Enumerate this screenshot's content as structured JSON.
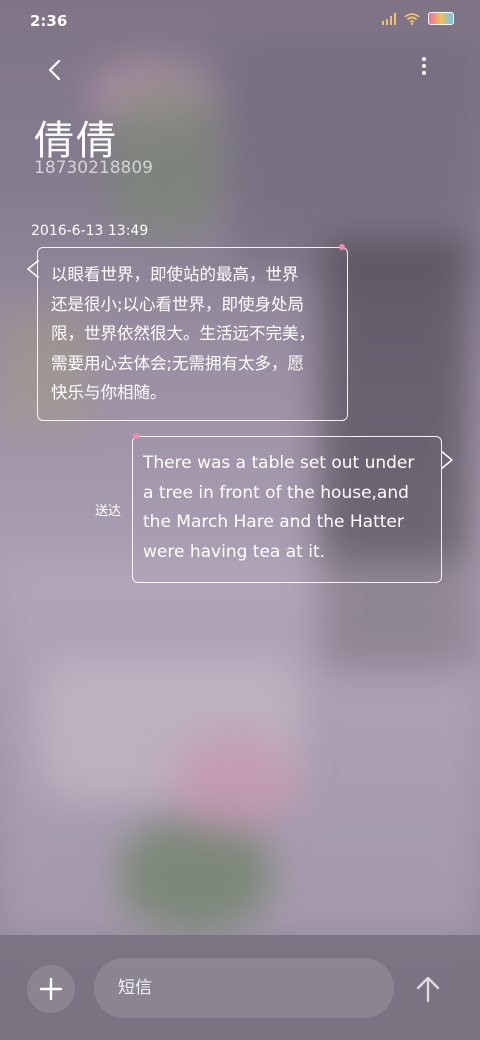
{
  "status_bar": {
    "time": "2:36"
  },
  "header": {
    "contact_name": "倩倩",
    "contact_number": "18730218809",
    "back_icon": "chevron-left-icon",
    "more_icon": "more-vertical-icon"
  },
  "conversation": {
    "timestamp": "2016-6-13 13:49",
    "messages": [
      {
        "direction": "incoming",
        "lines": [
          "以眼看世界，即使站的最高，世界",
          "还是很小;以心看世界，即使身处局",
          "限，世界依然很大。生活远不完美，",
          "需要用心去体会;无需拥有太多，愿",
          "快乐与你相随。"
        ]
      },
      {
        "direction": "outgoing",
        "status": "送达",
        "lines": [
          "There was a table set out under",
          "a tree in front of the house,and",
          "the March Hare and the Hatter",
          "were having tea at it."
        ]
      }
    ]
  },
  "composer": {
    "placeholder": "短信",
    "add_icon": "plus-icon",
    "send_icon": "arrow-up-icon"
  },
  "colors": {
    "bubble_border": "#ffffff",
    "accent_heart": "#f28aa8",
    "text": "#ffffff"
  }
}
